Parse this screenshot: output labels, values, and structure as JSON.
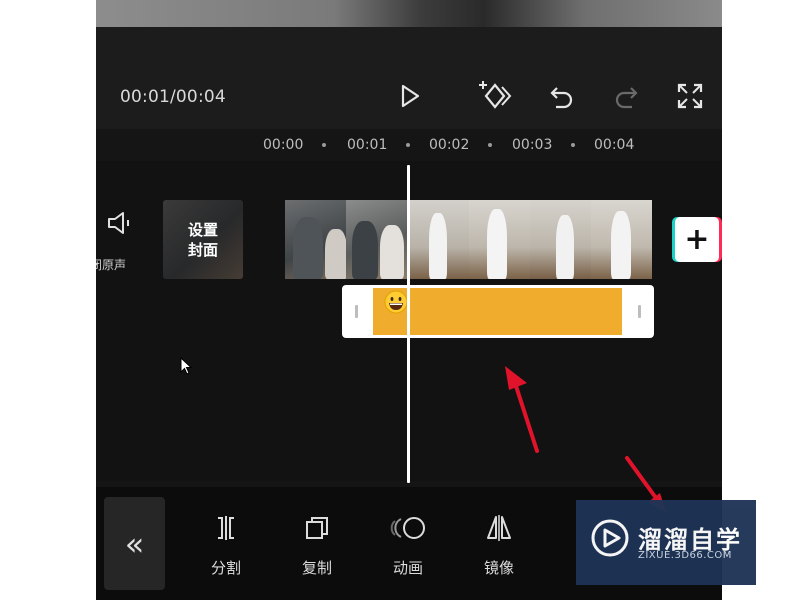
{
  "player": {
    "time": "00:01/00:04"
  },
  "ruler": {
    "ticks": [
      "00:00",
      "00:01",
      "00:02",
      "00:03",
      "00:04"
    ]
  },
  "track": {
    "mute_label": "闭原声",
    "cover_label_line1": "设置",
    "cover_label_line2": "封面",
    "add_label": "+"
  },
  "toolbar": {
    "back_label": "«",
    "items": [
      {
        "label": "分割",
        "icon": "split-icon"
      },
      {
        "label": "复制",
        "icon": "copy-icon"
      },
      {
        "label": "动画",
        "icon": "animation-icon"
      },
      {
        "label": "镜像",
        "icon": "mirror-icon"
      }
    ]
  },
  "watermark": {
    "title": "溜溜自学",
    "subtitle": "ZIXUE.3D66.COM"
  },
  "colors": {
    "sticker": "#f0ac2c",
    "annotation": "#e0132a",
    "watermark_bg": "#1e3456"
  }
}
